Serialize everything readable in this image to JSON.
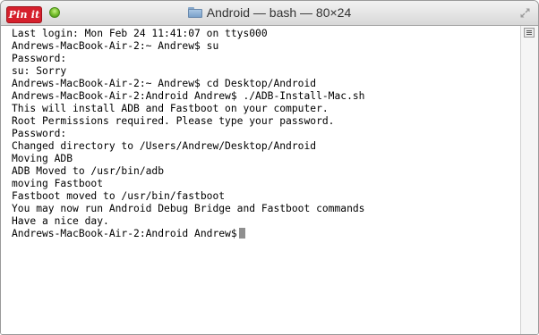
{
  "pin_button": {
    "label": "Pin it"
  },
  "window": {
    "title": "Android — bash — 80×24",
    "folder_icon": "folder-icon",
    "resize_icon": "fullscreen-arrows-icon"
  },
  "terminal": {
    "lines": [
      "Last login: Mon Feb 24 11:41:07 on ttys000",
      "Andrews-MacBook-Air-2:~ Andrew$ su",
      "Password:",
      "su: Sorry",
      "Andrews-MacBook-Air-2:~ Andrew$ cd Desktop/Android",
      "Andrews-MacBook-Air-2:Android Andrew$ ./ADB-Install-Mac.sh",
      "This will install ADB and Fastboot on your computer.",
      "Root Permissions required. Please type your password.",
      "Password:",
      "Changed directory to /Users/Andrew/Desktop/Android",
      "Moving ADB",
      "ADB Moved to /usr/bin/adb",
      "moving Fastboot",
      "Fastboot moved to /usr/bin/fastboot",
      "You may now run Android Debug Bridge and Fastboot commands",
      "Have a nice day.",
      "Andrews-MacBook-Air-2:Android Andrew$"
    ]
  },
  "colors": {
    "pin_red": "#d5202c",
    "zoom_green": "#7fc534",
    "cursor_gray": "#8f8f8f"
  }
}
